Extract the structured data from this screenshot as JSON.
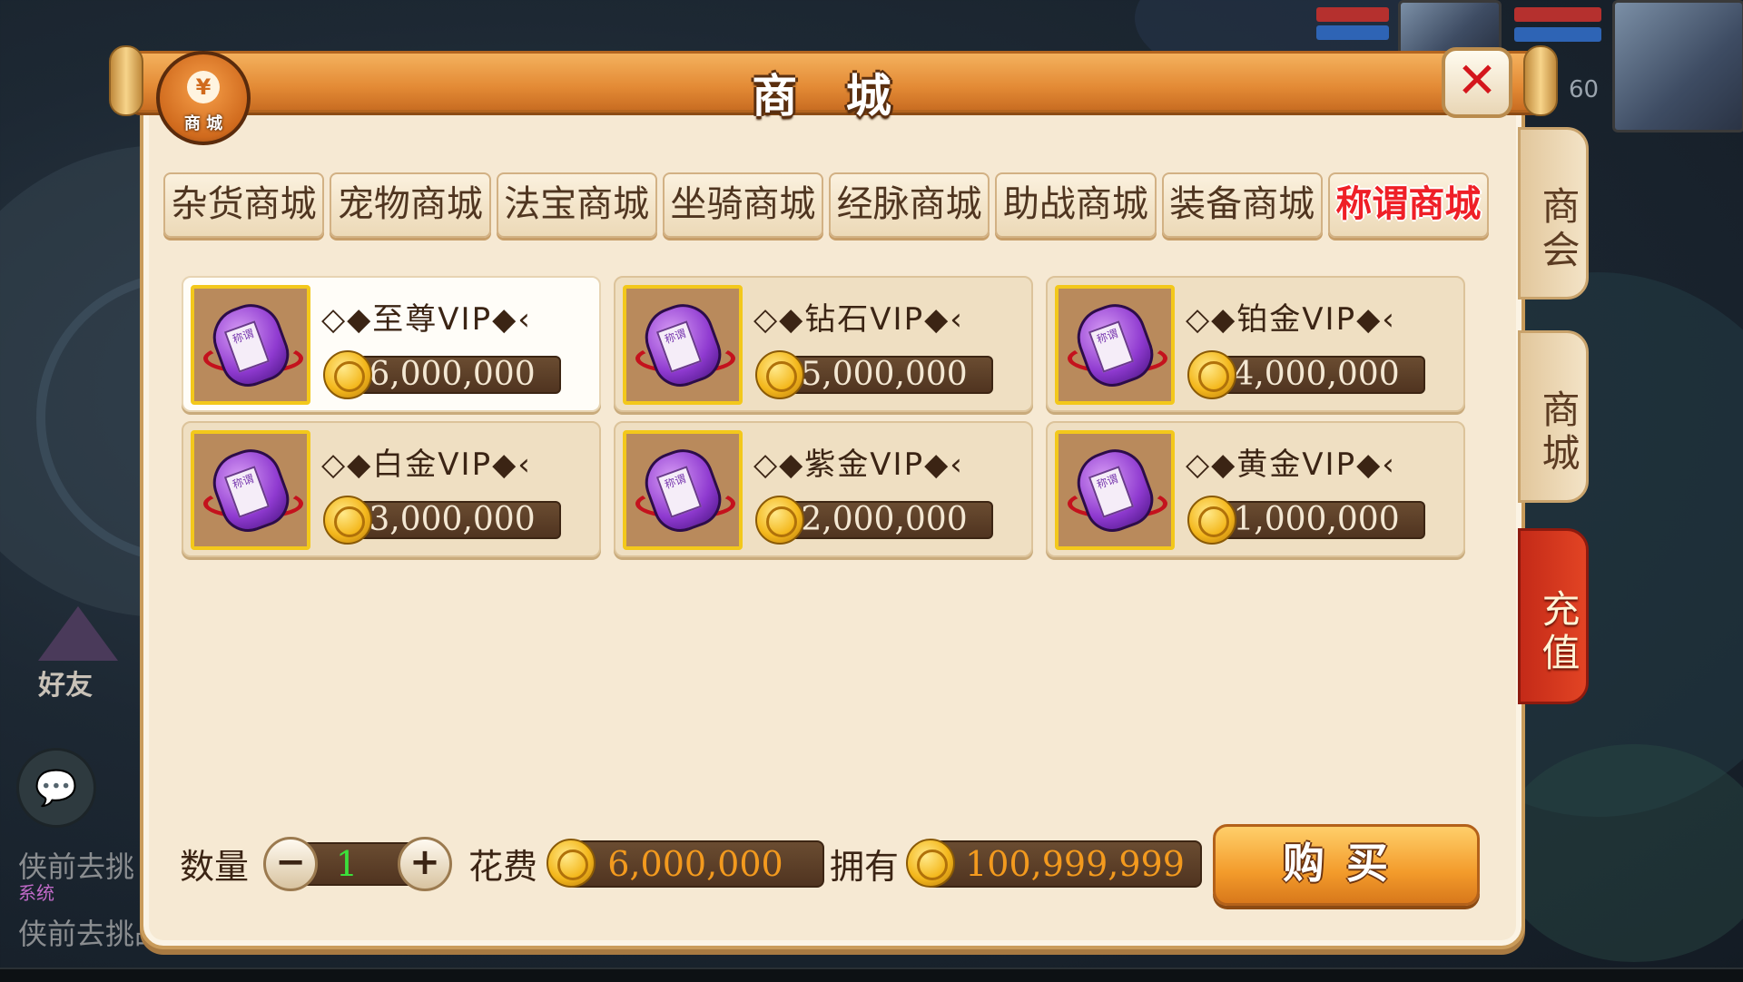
{
  "window": {
    "title": "商  城",
    "logo_label": "商 城",
    "logo_symbol": "¥"
  },
  "hud": {
    "level": "60"
  },
  "left_hud": {
    "friend_label": "好友",
    "chat_lines": [
      "侠前去挑",
      "系统",
      "侠前去挑战"
    ]
  },
  "tabs": [
    {
      "label": "杂货商城",
      "active": false
    },
    {
      "label": "宠物商城",
      "active": false
    },
    {
      "label": "法宝商城",
      "active": false
    },
    {
      "label": "坐骑商城",
      "active": false
    },
    {
      "label": "经脉商城",
      "active": false
    },
    {
      "label": "助战商城",
      "active": false
    },
    {
      "label": "装备商城",
      "active": false
    },
    {
      "label": "称谓商城",
      "active": true
    }
  ],
  "items": [
    {
      "name": "◇◆至尊VIP◆‹",
      "price": "6,000,000",
      "selected": true
    },
    {
      "name": "◇◆钻石VIP◆‹",
      "price": "5,000,000",
      "selected": false
    },
    {
      "name": "◇◆铂金VIP◆‹",
      "price": "4,000,000",
      "selected": false
    },
    {
      "name": "◇◆白金VIP◆‹",
      "price": "3,000,000",
      "selected": false
    },
    {
      "name": "◇◆紫金VIP◆‹",
      "price": "2,000,000",
      "selected": false
    },
    {
      "name": "◇◆黄金VIP◆‹",
      "price": "1,000,000",
      "selected": false
    }
  ],
  "item_icon": {
    "name": "title-scroll-icon",
    "tag": "称谓"
  },
  "side_tabs": [
    {
      "label": "商会"
    },
    {
      "label": "商城"
    },
    {
      "label": "充值"
    }
  ],
  "footer": {
    "qty_label": "数量",
    "qty_value": "1",
    "minus": "−",
    "plus": "+",
    "cost_label": "花费",
    "cost_value": "6,000,000",
    "have_label": "拥有",
    "have_value": "100,999,999",
    "buy_label": "购买"
  },
  "colors": {
    "active_tab": "#ef1f27",
    "price_text": "#f4e8d3",
    "qty_text": "#3be03b",
    "cost_text": "#f39a1e"
  }
}
